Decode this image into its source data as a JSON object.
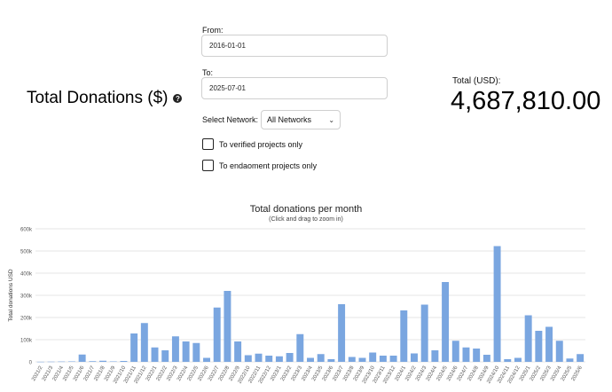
{
  "header": {
    "title": "Total Donations ($)",
    "help_icon": "question-circle-icon"
  },
  "filters": {
    "from_label": "From:",
    "from_value": "2016-01-01",
    "to_label": "To:",
    "to_value": "2025-07-01",
    "network_label": "Select Network:",
    "network_value": "All Networks",
    "verified_label": "To verified projects only",
    "endowment_label": "To endaoment projects only"
  },
  "total": {
    "label": "Total (USD):",
    "value": "4,687,810.00"
  },
  "chart_data": {
    "type": "bar",
    "title": "Total donations per month",
    "subtitle": "(Click and drag to zoom in)",
    "ylabel": "Total donations USD",
    "ylim": [
      0,
      600000
    ],
    "yticks": [
      "0",
      "100k",
      "200k",
      "300k",
      "400k",
      "500k",
      "600k"
    ],
    "color": "#7aa6e0",
    "categories": [
      "2021/2",
      "2021/3",
      "2021/4",
      "2021/5",
      "2021/6",
      "2021/7",
      "2021/8",
      "2021/9",
      "2021/10",
      "2021/11",
      "2021/12",
      "2022/1",
      "2022/2",
      "2022/3",
      "2022/4",
      "2022/5",
      "2022/6",
      "2022/7",
      "2022/8",
      "2022/9",
      "2022/10",
      "2022/11",
      "2022/12",
      "2023/1",
      "2023/2",
      "2023/3",
      "2023/4",
      "2023/5",
      "2023/6",
      "2023/7",
      "2023/8",
      "2023/9",
      "2023/10",
      "2023/11",
      "2023/12",
      "2024/1",
      "2024/2",
      "2024/3",
      "2024/4",
      "2024/5",
      "2024/6",
      "2024/7",
      "2024/8",
      "2024/9",
      "2024/10",
      "2024/11",
      "2024/12",
      "2025/1",
      "2025/2",
      "2025/3",
      "2025/4",
      "2025/5",
      "2025/6"
    ],
    "values": [
      500,
      1000,
      1500,
      2000,
      33000,
      3000,
      5000,
      2000,
      4000,
      128000,
      175000,
      65000,
      52000,
      115000,
      92000,
      85000,
      18000,
      245000,
      320000,
      92000,
      30000,
      37000,
      28000,
      25000,
      40000,
      125000,
      18000,
      35000,
      12000,
      260000,
      22000,
      18000,
      42000,
      28000,
      28000,
      232000,
      38000,
      258000,
      52000,
      360000,
      95000,
      65000,
      60000,
      32000,
      522000,
      12000,
      18000,
      210000,
      140000,
      158000,
      95000,
      15000,
      35000
    ],
    "xtick_labels": [
      "2021/2",
      "2021/3",
      "2021/4",
      "2021/5",
      "2021/6",
      "2021/7",
      "2021/8",
      "2021/9",
      "2021/10",
      "2021/11",
      "2021/12",
      "2022/1",
      "2022/2",
      "2022/3",
      "2022/4",
      "2022/5",
      "2022/6",
      "2022/7",
      "2022/8",
      "2022/9",
      "2022/10",
      "2022/11",
      "2022/12",
      "2023/1",
      "2023/2",
      "2023/3",
      "2023/4",
      "2023/5",
      "2023/6",
      "2023/7",
      "2023/8",
      "2023/9",
      "2023/10",
      "2023/11",
      "2023/12",
      "2024/1",
      "2024/2",
      "2024/3",
      "2024/4",
      "2024/5",
      "2024/6",
      "2024/7",
      "2024/8",
      "2024/9",
      "2024/10",
      "2024/11",
      "2024/12",
      "2025/1",
      "2025/2",
      "2025/3",
      "2025/4",
      "2025/5",
      "2025/6"
    ]
  }
}
